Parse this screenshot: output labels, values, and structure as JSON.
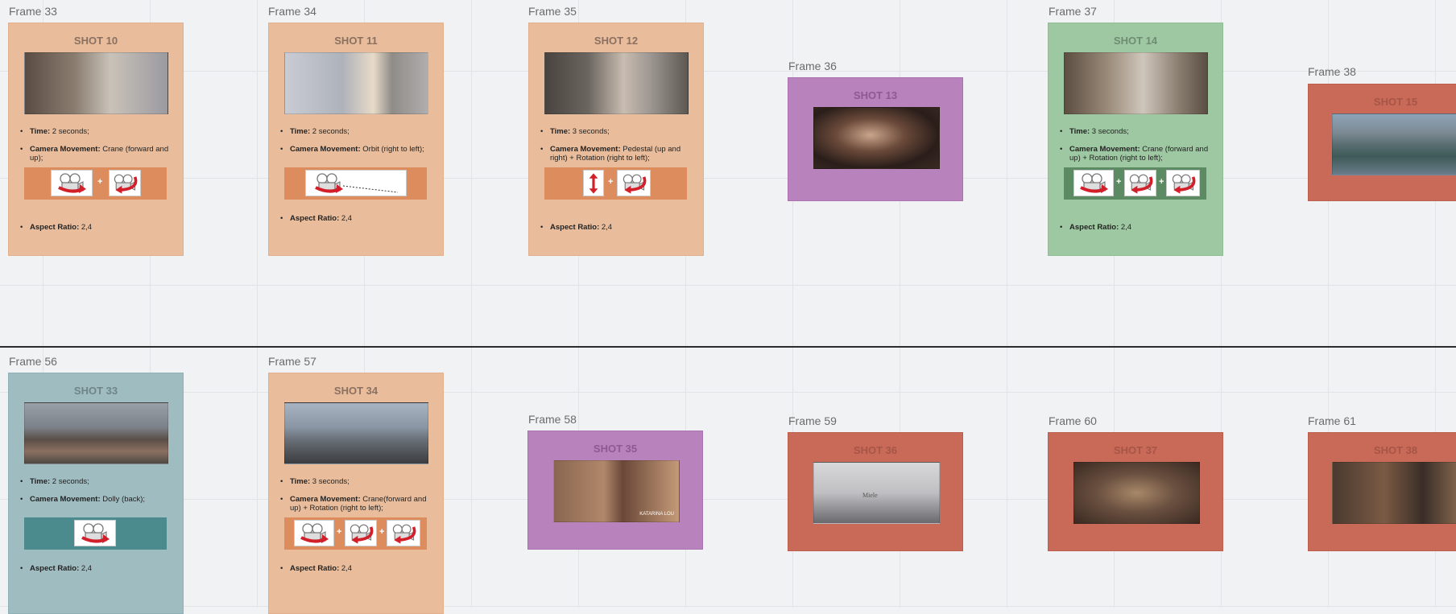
{
  "colors": {
    "canvas": "#f1f2f4",
    "peach": "#e9bd9c",
    "green": "#9ec8a2",
    "teal": "#9fbcc1",
    "purple": "#b882bd",
    "red": "#c96a59"
  },
  "frames": {
    "f33": {
      "label": "Frame 33",
      "shot": "SHOT 10",
      "time_label": "Time:",
      "time": " 2 seconds;",
      "move_label": "Camera Movement:",
      "move": " Crane (forward and up);",
      "aspect_label": "Aspect Ratio:",
      "aspect": " 2,4"
    },
    "f34": {
      "label": "Frame 34",
      "shot": "SHOT 11",
      "time_label": "Time:",
      "time": " 2 seconds;",
      "move_label": "Camera Movement:",
      "move": " Orbit (right to left);",
      "aspect_label": "Aspect Ratio:",
      "aspect": " 2,4"
    },
    "f35": {
      "label": "Frame 35",
      "shot": "SHOT 12",
      "time_label": "Time:",
      "time": " 3 seconds;",
      "move_label": "Camera Movement:",
      "move": " Pedestal (up and right) + Rotation (right to left);",
      "aspect_label": "Aspect Ratio:",
      "aspect": " 2,4"
    },
    "f36": {
      "label": "Frame 36",
      "shot": "SHOT 13"
    },
    "f37": {
      "label": "Frame 37",
      "shot": "SHOT 14",
      "time_label": "Time:",
      "time": " 3 seconds;",
      "move_label": "Camera Movement:",
      "move": " Crane (forward and up) + Rotation (right to left);",
      "aspect_label": "Aspect Ratio:",
      "aspect": " 2,4"
    },
    "f38": {
      "label": "Frame 38",
      "shot": "SHOT 15"
    },
    "f56": {
      "label": "Frame 56",
      "shot": "SHOT 33",
      "time_label": "Time:",
      "time": " 2 seconds;",
      "move_label": "Camera Movement:",
      "move": " Dolly (back);",
      "aspect_label": "Aspect Ratio:",
      "aspect": " 2,4"
    },
    "f57": {
      "label": "Frame 57",
      "shot": "SHOT 34",
      "time_label": "Time:",
      "time": " 3 seconds;",
      "move_label": "Camera Movement:",
      "move": " Crane(forward and up) + Rotation (right to left);",
      "aspect_label": "Aspect Ratio:",
      "aspect": " 2,4"
    },
    "f58": {
      "label": "Frame 58",
      "shot": "SHOT 35",
      "caption": "KATARINA LOU"
    },
    "f59": {
      "label": "Frame 59",
      "shot": "SHOT 36",
      "brand": "Miele"
    },
    "f60": {
      "label": "Frame 60",
      "shot": "SHOT 37"
    },
    "f61": {
      "label": "Frame 61",
      "shot": "SHOT 38"
    }
  },
  "plus": "+"
}
